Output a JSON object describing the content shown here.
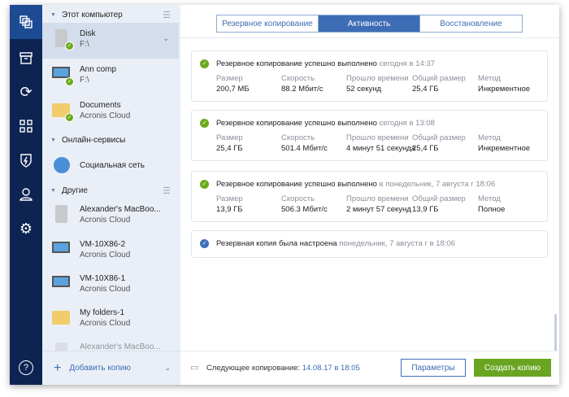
{
  "nav": {
    "items": [
      "backup",
      "archive",
      "sync",
      "tools",
      "protection",
      "account",
      "settings",
      "help"
    ]
  },
  "sidebar": {
    "sections": [
      {
        "label": "Этот компьютер"
      },
      {
        "label": "Онлайн-сервисы"
      },
      {
        "label": "Другие"
      }
    ],
    "items": [
      {
        "name": "Disk",
        "sub": "F:\\",
        "type": "disk"
      },
      {
        "name": "Ann comp",
        "sub": "F:\\",
        "type": "monitor"
      },
      {
        "name": "Documents",
        "sub": "Acronis Cloud",
        "type": "folder"
      },
      {
        "name": "Социальная сеть",
        "sub": "",
        "type": "globe"
      },
      {
        "name": "Alexander's MacBoo...",
        "sub": "Acronis Cloud",
        "type": "disk"
      },
      {
        "name": "VM-10X86-2",
        "sub": "Acronis Cloud",
        "type": "monitor"
      },
      {
        "name": "VM-10X86-1",
        "sub": "Acronis Cloud",
        "type": "monitor"
      },
      {
        "name": "My folders-1",
        "sub": "Acronis Cloud",
        "type": "folder"
      },
      {
        "name": "Alexander's MacBoo...",
        "sub": "Acronis Cloud",
        "type": "disk"
      }
    ],
    "add_label": "Добавить копию"
  },
  "tabs": [
    "Резервное копирование",
    "Активность",
    "Восстановление"
  ],
  "labels": {
    "size": "Размер",
    "speed": "Скорость",
    "elapsed": "Прошло времени",
    "total": "Общий размер",
    "method": "Метод"
  },
  "activities": [
    {
      "title": "Резервное копирование успешно выполнено",
      "when": "сегодня в 14:37",
      "size": "200,7 МБ",
      "speed": "88.2 Мбит/с",
      "elapsed": "52 секунд",
      "total": "25,4 ГБ",
      "method": "Инкрементное"
    },
    {
      "title": "Резервное копирование успешно выполнено",
      "when": "сегодня в 13:08",
      "size": "25,4 ГБ",
      "speed": "501.4 Мбит/с",
      "elapsed": "4 минут 51 секунда",
      "total": "25,4 ГБ",
      "method": "Инкрементное"
    },
    {
      "title": "Резервное копирование успешно выполнено",
      "when": "в понедельник, 7 августа г 18:06",
      "size": "13,9 ГБ",
      "speed": "506.3 Мбит/с",
      "elapsed": "2 минут 57 секунд",
      "total": "13,9 ГБ",
      "method": "Полное"
    },
    {
      "title": "Резервная копия была настроена",
      "when": "понедельник, 7 августа г в 18:06"
    }
  ],
  "footer": {
    "next_label": "Следующее копирование:",
    "next_value": "14.08.17 в 18:05",
    "params": "Параметры",
    "create": "Создать копию"
  }
}
